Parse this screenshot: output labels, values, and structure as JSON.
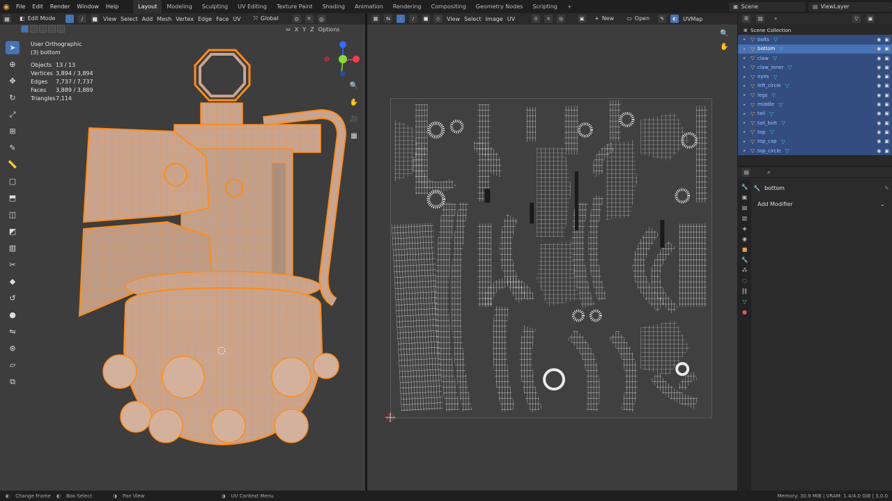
{
  "topbar": {
    "logo_icon": "blender-logo-icon",
    "menu": [
      "File",
      "Edit",
      "Render",
      "Window",
      "Help"
    ],
    "workspaces": [
      "Layout",
      "Modeling",
      "Sculpting",
      "UV Editing",
      "Texture Paint",
      "Shading",
      "Animation",
      "Rendering",
      "Compositing",
      "Geometry Nodes",
      "Scripting"
    ],
    "active_workspace": "Layout",
    "add_workspace": "+",
    "scene": "Scene",
    "view_layer": "ViewLayer"
  },
  "viewport": {
    "mode": "Edit Mode",
    "menus": [
      "View",
      "Select",
      "Add",
      "Mesh",
      "Vertex",
      "Edge",
      "Face",
      "UV"
    ],
    "orientation": "Global",
    "options": "Options",
    "axes": [
      "X",
      "Y",
      "Z"
    ],
    "view_name": "User Orthographic",
    "object_label": "(3) bottom",
    "stats": [
      {
        "k": "Objects",
        "v": "13 / 13"
      },
      {
        "k": "Vertices",
        "v": "3,894 / 3,894"
      },
      {
        "k": "Edges",
        "v": "7,737 / 7,737"
      },
      {
        "k": "Faces",
        "v": "3,889 / 3,889"
      },
      {
        "k": "Triangles",
        "v": "7,114"
      }
    ]
  },
  "uv_editor": {
    "menus": [
      "View",
      "Select",
      "Image",
      "UV"
    ],
    "new_label": "New",
    "open_label": "Open",
    "uvmap_label": "UVMap"
  },
  "outliner": {
    "collection": "Scene Collection",
    "items": [
      "bolts",
      "bottom",
      "claw",
      "claw_inner",
      "eyes",
      "left_circle",
      "legs",
      "middle",
      "tail",
      "tail_bolt",
      "top",
      "top_cap",
      "top_circle"
    ],
    "active_item": "bottom"
  },
  "properties": {
    "object_name": "bottom",
    "add_modifier": "Add Modifier"
  },
  "statusbar": {
    "items": [
      "Change Frame",
      "Box Select",
      "Pan View",
      "UV Context Menu"
    ],
    "memory": "Memory: 30.9 MiB | VRAM: 1.4/4.0 GiB | 3.0.0"
  },
  "colors": {
    "accent": "#4772b3",
    "selection_orange": "#ff8c1a",
    "mesh_body": "#c9a48f",
    "uv_wire": "#e6e6e6"
  }
}
